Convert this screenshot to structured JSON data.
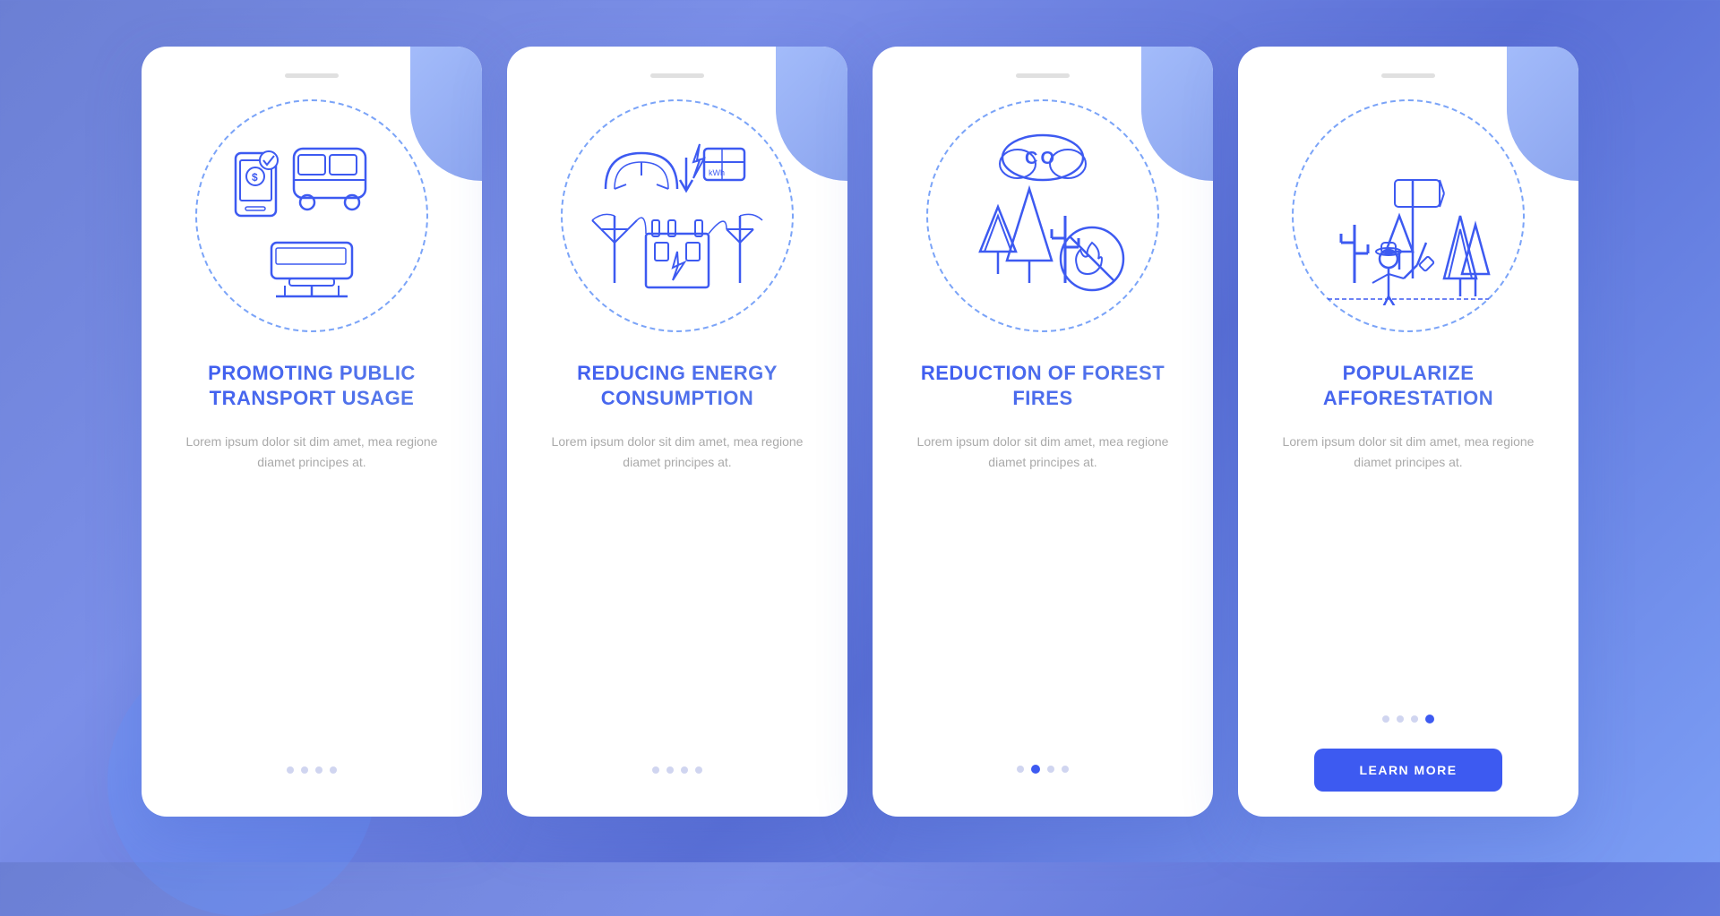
{
  "cards": [
    {
      "id": "card-1",
      "title": "PROMOTING PUBLIC TRANSPORT USAGE",
      "body_text": "Lorem ipsum dolor sit dim amet, mea regione diamet principes at.",
      "dots": [
        false,
        false,
        false,
        false
      ],
      "active_dot": -1,
      "show_button": false,
      "button_label": ""
    },
    {
      "id": "card-2",
      "title": "REDUCING ENERGY CONSUMPTION",
      "body_text": "Lorem ipsum dolor sit dim amet, mea regione diamet principes at.",
      "dots": [
        false,
        false,
        false,
        false
      ],
      "active_dot": -1,
      "show_button": false,
      "button_label": ""
    },
    {
      "id": "card-3",
      "title": "REDUCTION OF FOREST FIRES",
      "body_text": "Lorem ipsum dolor sit dim amet, mea regione diamet principes at.",
      "dots": [
        false,
        false,
        false,
        false
      ],
      "active_dot": 1,
      "show_button": false,
      "button_label": ""
    },
    {
      "id": "card-4",
      "title": "POPULARIZE AFFORESTATION",
      "body_text": "Lorem ipsum dolor sit dim amet, mea regione diamet principes at.",
      "dots": [
        false,
        false,
        false,
        false
      ],
      "active_dot": 3,
      "show_button": true,
      "button_label": "LEARN MORE"
    }
  ]
}
